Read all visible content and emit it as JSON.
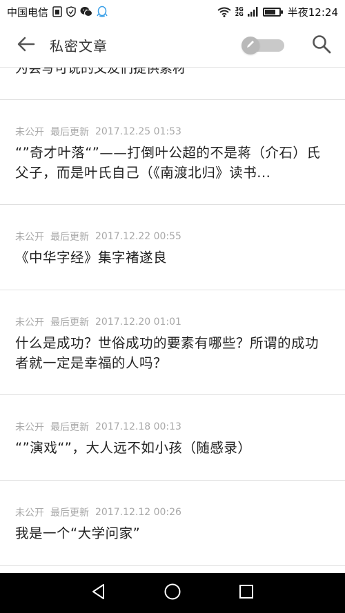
{
  "status_bar": {
    "carrier": "中国电信",
    "network_top": "3G",
    "network_bottom": "2G",
    "time": "半夜12:24",
    "battery_level": 0.75
  },
  "app_bar": {
    "title": "私密文章"
  },
  "partial_item": {
    "text": "为会写可说的文友们提供素材"
  },
  "articles": [
    {
      "status": "未公开",
      "updated_label": "最后更新",
      "date": "2017.12.25 01:53",
      "title": "“”奇才叶落“”——打倒叶公超的不是蒋（介石）氏父子，而是叶氏自己（《南渡北归》读书..."
    },
    {
      "status": "未公开",
      "updated_label": "最后更新",
      "date": "2017.12.22 00:55",
      "title": "《中华字经》集字褚遂良"
    },
    {
      "status": "未公开",
      "updated_label": "最后更新",
      "date": "2017.12.20 01:01",
      "title": "什么是成功？世俗成功的要素有哪些？所谓的成功者就一定是幸福的人吗？"
    },
    {
      "status": "未公开",
      "updated_label": "最后更新",
      "date": "2017.12.18 00:13",
      "title": "“”演戏“”，大人远不如小孩（随感录）"
    },
    {
      "status": "未公开",
      "updated_label": "最后更新",
      "date": "2017.12.12 00:26",
      "title": "我是一个“大学问家”"
    }
  ],
  "icons": {
    "back": "arrow-left-icon",
    "toggle": "pencil-icon",
    "search": "search-icon",
    "nav_back": "triangle-back-icon",
    "nav_home": "circle-home-icon",
    "nav_recent": "square-recent-icon"
  },
  "colors": {
    "meta_text": "#a8a8a8",
    "title_text": "#222222",
    "divider": "#e0e0e0",
    "nav_bar": "#000000"
  }
}
